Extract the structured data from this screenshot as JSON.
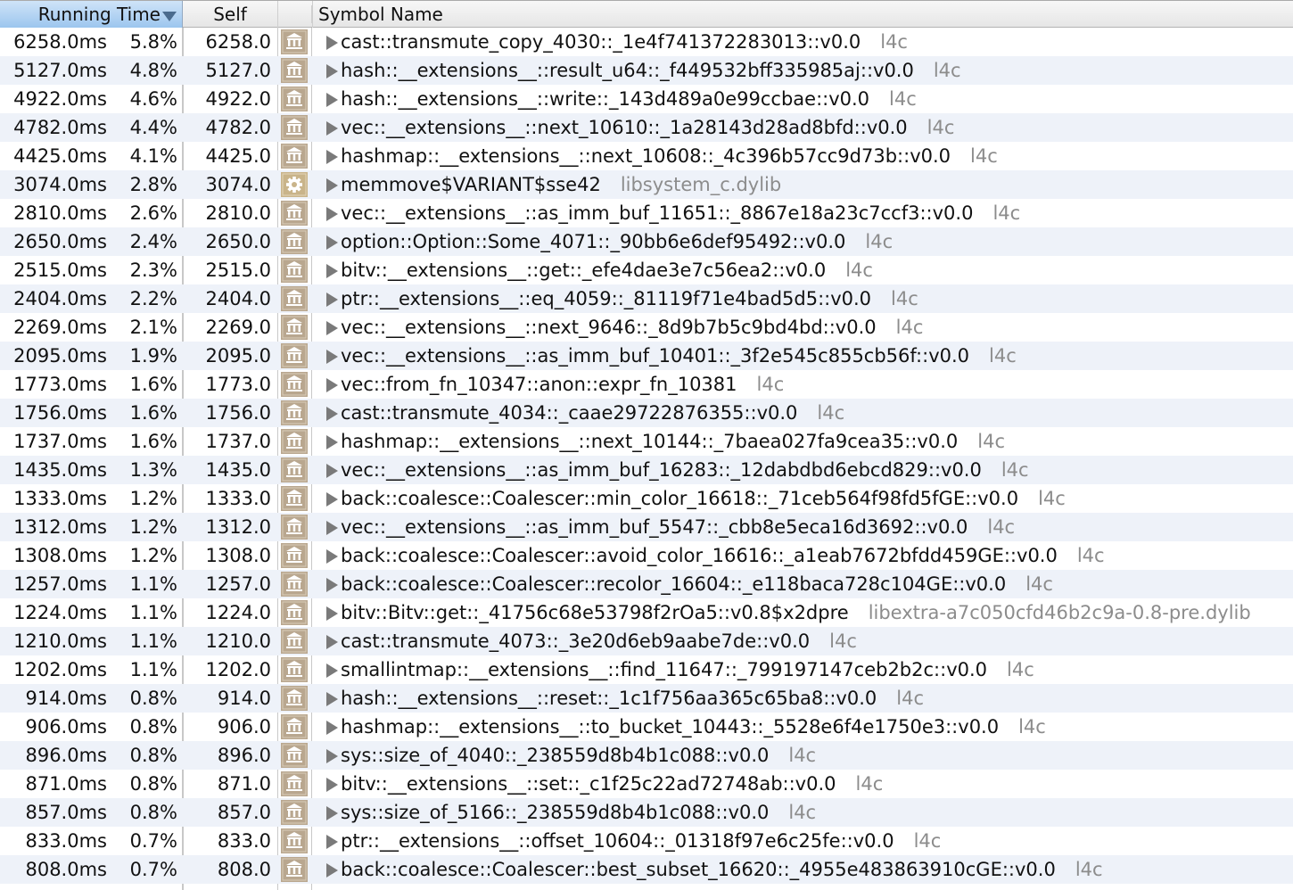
{
  "header": {
    "running_time": "Running Time",
    "self": "Self",
    "symbol_name": "Symbol Name",
    "sort_direction": "descending"
  },
  "colors": {
    "header_selected": "#a9cdf0",
    "alt_row": "#eef2f9",
    "library_text": "#8c8c8c",
    "icon_library": "#b9a78f",
    "icon_system": "#c9b48a"
  },
  "rows": [
    {
      "ms": "6258.0ms",
      "pct": "5.8%",
      "self": "6258.0",
      "icon": "library-icon",
      "symbol": "cast::transmute_copy_4030::_1e4f741372283013::v0.0",
      "lib": "l4c"
    },
    {
      "ms": "5127.0ms",
      "pct": "4.8%",
      "self": "5127.0",
      "icon": "library-icon",
      "symbol": "hash::__extensions__::result_u64::_f449532bff335985aj::v0.0",
      "lib": "l4c"
    },
    {
      "ms": "4922.0ms",
      "pct": "4.6%",
      "self": "4922.0",
      "icon": "library-icon",
      "symbol": "hash::__extensions__::write::_143d489a0e99ccbae::v0.0",
      "lib": "l4c"
    },
    {
      "ms": "4782.0ms",
      "pct": "4.4%",
      "self": "4782.0",
      "icon": "library-icon",
      "symbol": "vec::__extensions__::next_10610::_1a28143d28ad8bfd::v0.0",
      "lib": "l4c"
    },
    {
      "ms": "4425.0ms",
      "pct": "4.1%",
      "self": "4425.0",
      "icon": "library-icon",
      "symbol": "hashmap::__extensions__::next_10608::_4c396b57cc9d73b::v0.0",
      "lib": "l4c"
    },
    {
      "ms": "3074.0ms",
      "pct": "2.8%",
      "self": "3074.0",
      "icon": "gear-icon",
      "symbol": "memmove$VARIANT$sse42",
      "lib": "libsystem_c.dylib"
    },
    {
      "ms": "2810.0ms",
      "pct": "2.6%",
      "self": "2810.0",
      "icon": "library-icon",
      "symbol": "vec::__extensions__::as_imm_buf_11651::_8867e18a23c7ccf3::v0.0",
      "lib": "l4c"
    },
    {
      "ms": "2650.0ms",
      "pct": "2.4%",
      "self": "2650.0",
      "icon": "library-icon",
      "symbol": "option::Option::Some_4071::_90bb6e6def95492::v0.0",
      "lib": "l4c"
    },
    {
      "ms": "2515.0ms",
      "pct": "2.3%",
      "self": "2515.0",
      "icon": "library-icon",
      "symbol": "bitv::__extensions__::get::_efe4dae3e7c56ea2::v0.0",
      "lib": "l4c"
    },
    {
      "ms": "2404.0ms",
      "pct": "2.2%",
      "self": "2404.0",
      "icon": "library-icon",
      "symbol": "ptr::__extensions__::eq_4059::_81119f71e4bad5d5::v0.0",
      "lib": "l4c"
    },
    {
      "ms": "2269.0ms",
      "pct": "2.1%",
      "self": "2269.0",
      "icon": "library-icon",
      "symbol": "vec::__extensions__::next_9646::_8d9b7b5c9bd4bd::v0.0",
      "lib": "l4c"
    },
    {
      "ms": "2095.0ms",
      "pct": "1.9%",
      "self": "2095.0",
      "icon": "library-icon",
      "symbol": "vec::__extensions__::as_imm_buf_10401::_3f2e545c855cb56f::v0.0",
      "lib": "l4c"
    },
    {
      "ms": "1773.0ms",
      "pct": "1.6%",
      "self": "1773.0",
      "icon": "library-icon",
      "symbol": "vec::from_fn_10347::anon::expr_fn_10381",
      "lib": "l4c"
    },
    {
      "ms": "1756.0ms",
      "pct": "1.6%",
      "self": "1756.0",
      "icon": "library-icon",
      "symbol": "cast::transmute_4034::_caae29722876355::v0.0",
      "lib": "l4c"
    },
    {
      "ms": "1737.0ms",
      "pct": "1.6%",
      "self": "1737.0",
      "icon": "library-icon",
      "symbol": "hashmap::__extensions__::next_10144::_7baea027fa9cea35::v0.0",
      "lib": "l4c"
    },
    {
      "ms": "1435.0ms",
      "pct": "1.3%",
      "self": "1435.0",
      "icon": "library-icon",
      "symbol": "vec::__extensions__::as_imm_buf_16283::_12dabdbd6ebcd829::v0.0",
      "lib": "l4c"
    },
    {
      "ms": "1333.0ms",
      "pct": "1.2%",
      "self": "1333.0",
      "icon": "library-icon",
      "symbol": "back::coalesce::Coalescer::min_color_16618::_71ceb564f98fd5fGE::v0.0",
      "lib": "l4c"
    },
    {
      "ms": "1312.0ms",
      "pct": "1.2%",
      "self": "1312.0",
      "icon": "library-icon",
      "symbol": "vec::__extensions__::as_imm_buf_5547::_cbb8e5eca16d3692::v0.0",
      "lib": "l4c"
    },
    {
      "ms": "1308.0ms",
      "pct": "1.2%",
      "self": "1308.0",
      "icon": "library-icon",
      "symbol": "back::coalesce::Coalescer::avoid_color_16616::_a1eab7672bfdd459GE::v0.0",
      "lib": "l4c"
    },
    {
      "ms": "1257.0ms",
      "pct": "1.1%",
      "self": "1257.0",
      "icon": "library-icon",
      "symbol": "back::coalesce::Coalescer::recolor_16604::_e118baca728c104GE::v0.0",
      "lib": "l4c"
    },
    {
      "ms": "1224.0ms",
      "pct": "1.1%",
      "self": "1224.0",
      "icon": "library-icon",
      "symbol": "bitv::Bitv::get::_41756c68e53798f2rOa5::v0.8$x2dpre",
      "lib": "libextra-a7c050cfd46b2c9a-0.8-pre.dylib"
    },
    {
      "ms": "1210.0ms",
      "pct": "1.1%",
      "self": "1210.0",
      "icon": "library-icon",
      "symbol": "cast::transmute_4073::_3e20d6eb9aabe7de::v0.0",
      "lib": "l4c"
    },
    {
      "ms": "1202.0ms",
      "pct": "1.1%",
      "self": "1202.0",
      "icon": "library-icon",
      "symbol": "smallintmap::__extensions__::find_11647::_799197147ceb2b2c::v0.0",
      "lib": "l4c"
    },
    {
      "ms": "914.0ms",
      "pct": "0.8%",
      "self": "914.0",
      "icon": "library-icon",
      "symbol": "hash::__extensions__::reset::_1c1f756aa365c65ba8::v0.0",
      "lib": "l4c"
    },
    {
      "ms": "906.0ms",
      "pct": "0.8%",
      "self": "906.0",
      "icon": "library-icon",
      "symbol": "hashmap::__extensions__::to_bucket_10443::_5528e6f4e1750e3::v0.0",
      "lib": "l4c"
    },
    {
      "ms": "896.0ms",
      "pct": "0.8%",
      "self": "896.0",
      "icon": "library-icon",
      "symbol": "sys::size_of_4040::_238559d8b4b1c088::v0.0",
      "lib": "l4c"
    },
    {
      "ms": "871.0ms",
      "pct": "0.8%",
      "self": "871.0",
      "icon": "library-icon",
      "symbol": "bitv::__extensions__::set::_c1f25c22ad72748ab::v0.0",
      "lib": "l4c"
    },
    {
      "ms": "857.0ms",
      "pct": "0.8%",
      "self": "857.0",
      "icon": "library-icon",
      "symbol": "sys::size_of_5166::_238559d8b4b1c088::v0.0",
      "lib": "l4c"
    },
    {
      "ms": "833.0ms",
      "pct": "0.7%",
      "self": "833.0",
      "icon": "library-icon",
      "symbol": "ptr::__extensions__::offset_10604::_01318f97e6c25fe::v0.0",
      "lib": "l4c"
    },
    {
      "ms": "808.0ms",
      "pct": "0.7%",
      "self": "808.0",
      "icon": "library-icon",
      "symbol": "back::coalesce::Coalescer::best_subset_16620::_4955e483863910cGE::v0.0",
      "lib": "l4c"
    }
  ]
}
